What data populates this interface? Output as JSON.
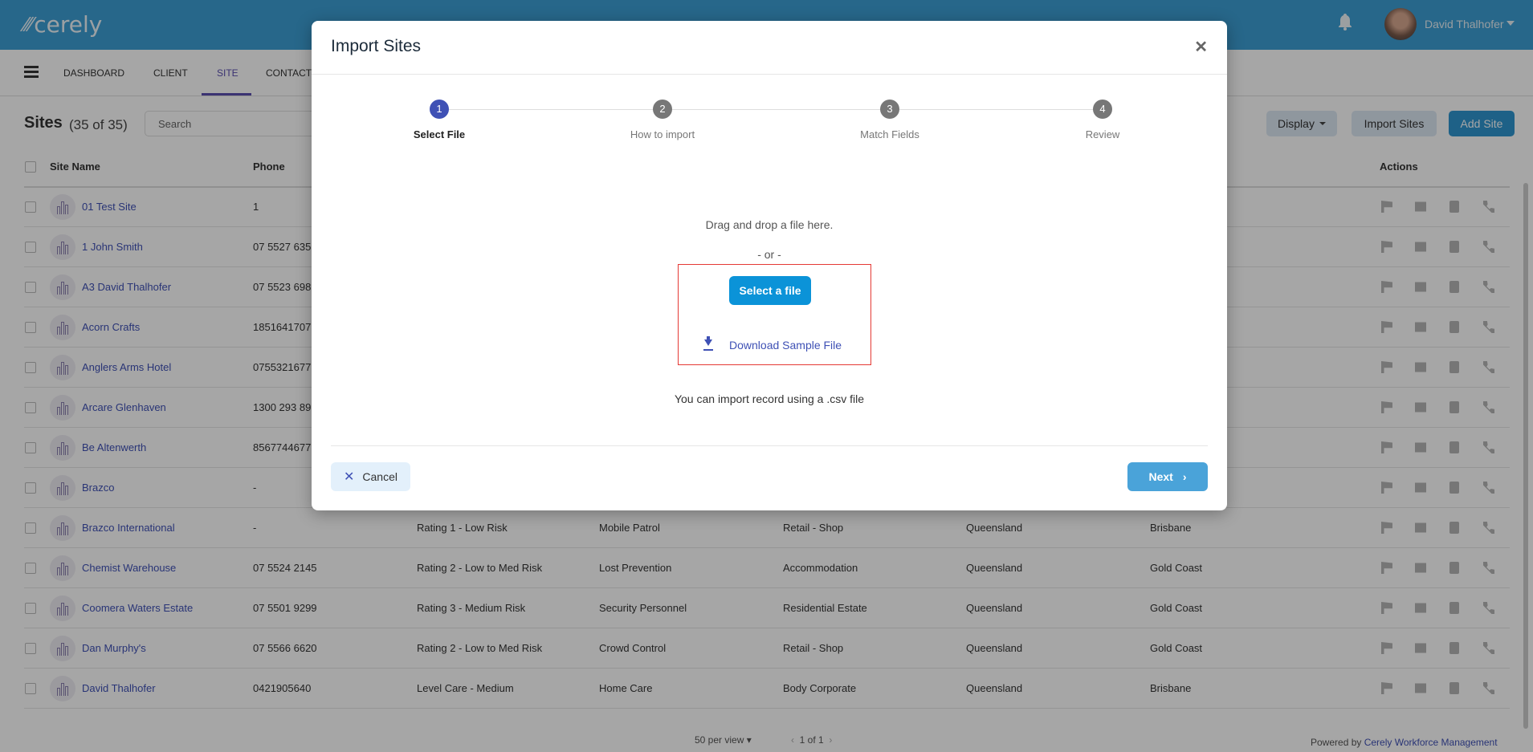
{
  "app": {
    "logo": "cerely",
    "user_name": "David Thalhofer"
  },
  "nav": {
    "items": [
      "DASHBOARD",
      "CLIENT",
      "SITE",
      "CONTACT"
    ],
    "active": "SITE"
  },
  "page": {
    "title": "Sites",
    "count": "(35 of 35)",
    "search_placeholder": "Search",
    "display_label": "Display",
    "import_label": "Import Sites",
    "add_label": "Add Site"
  },
  "table": {
    "headers": {
      "name": "Site Name",
      "phone": "Phone",
      "actions": "Actions"
    },
    "rows": [
      {
        "name": "01 Test Site",
        "phone": "1"
      },
      {
        "name": "1 John Smith",
        "phone": "07 5527 635"
      },
      {
        "name": "A3 David Thalhofer",
        "phone": "07 5523 698"
      },
      {
        "name": "Acorn Crafts",
        "phone": "1851641707"
      },
      {
        "name": "Anglers Arms Hotel",
        "phone": "0755321677"
      },
      {
        "name": "Arcare Glenhaven",
        "phone": "1300 293 89"
      },
      {
        "name": "Be Altenwerth",
        "phone": "8567744677"
      },
      {
        "name": "Brazco",
        "phone": "-"
      },
      {
        "name": "Brazco International",
        "phone": "-",
        "rating": "Rating 1 - Low Risk",
        "service": "Mobile Patrol",
        "type": "Retail - Shop",
        "state": "Queensland",
        "city": "Brisbane"
      },
      {
        "name": "Chemist Warehouse",
        "phone": "07 5524 2145",
        "rating": "Rating 2 - Low to Med Risk",
        "service": "Lost Prevention",
        "type": "Accommodation",
        "state": "Queensland",
        "city": "Gold Coast"
      },
      {
        "name": "Coomera Waters Estate",
        "phone": "07 5501 9299",
        "rating": "Rating 3 - Medium Risk",
        "service": "Security Personnel",
        "type": "Residential Estate",
        "state": "Queensland",
        "city": "Gold Coast"
      },
      {
        "name": "Dan Murphy's",
        "phone": "07 5566 6620",
        "rating": "Rating 2 - Low to Med Risk",
        "service": "Crowd Control",
        "type": "Retail - Shop",
        "state": "Queensland",
        "city": "Gold Coast"
      },
      {
        "name": "David Thalhofer",
        "phone": "0421905640",
        "rating": "Level Care - Medium",
        "service": "Home Care",
        "type": "Body Corporate",
        "state": "Queensland",
        "city": "Brisbane"
      }
    ]
  },
  "footer": {
    "per_view": "50 per view",
    "pages": "1 of 1",
    "powered_prefix": "Powered by",
    "powered_link": "Cerely Workforce Management"
  },
  "modal": {
    "title": "Import Sites",
    "steps": [
      {
        "num": "1",
        "label": "Select File"
      },
      {
        "num": "2",
        "label": "How to import"
      },
      {
        "num": "3",
        "label": "Match Fields"
      },
      {
        "num": "4",
        "label": "Review"
      }
    ],
    "active_step": 1,
    "drag_text": "Drag and drop a file here.",
    "or_text": "- or -",
    "select_label": "Select a file",
    "download_label": "Download Sample File",
    "hint": "You can import record using a .csv file",
    "cancel_label": "Cancel",
    "next_label": "Next"
  },
  "colors": {
    "header": "#3d9ed4",
    "accent": "#3f51b5",
    "primary_button": "#0b93d8",
    "highlight_box": "#e53935"
  }
}
